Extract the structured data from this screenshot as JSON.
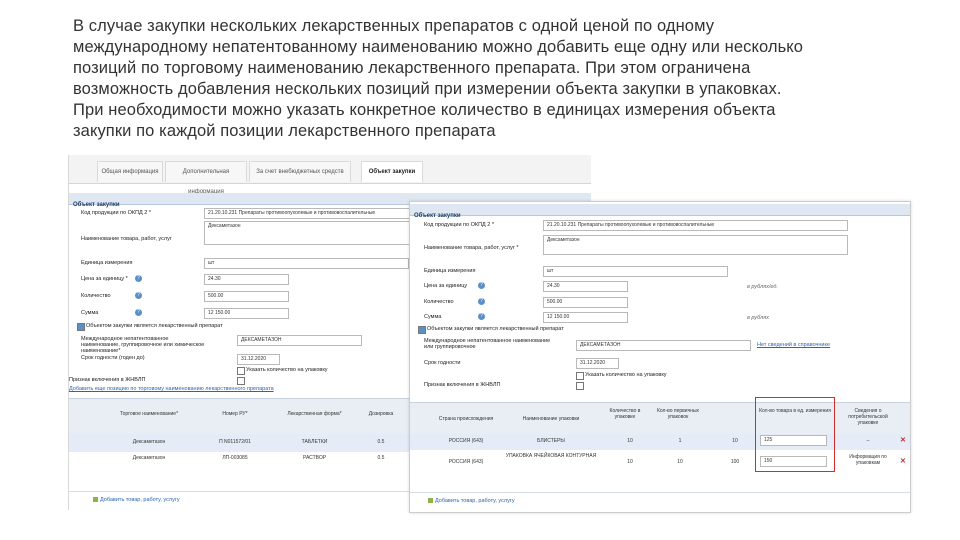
{
  "intro_lines": [
    "В случае закупки нескольких лекарственных препаратов с одной ценой по одному",
    "международному непатентованному наименованию можно добавить еще одну или несколько",
    "позиций по торговому наименованию лекарственного препарата. При этом ограничена",
    "возможность добавления нескольких позиций при измерении объекта закупки в упаковках.",
    "При необходимости можно указать конкретное количество в единицах измерения объекта",
    "закупки по каждой позиции лекарственного препарата"
  ],
  "back": {
    "tabs": [
      "Общая информация",
      "Дополнительная информация",
      "За счет внебюджетных средств",
      "Объект закупки"
    ],
    "section": "Объект закупки",
    "fields": [
      {
        "label": "Код продукции по ОКПД 2 *",
        "value": "21.20.10.231 Препараты противоопухолевые и противовоспалительные"
      },
      {
        "label": "Наименование товара, работ, услуг",
        "value": "Дексаметазон"
      },
      {
        "label": "Единица измерения",
        "value": "шт"
      },
      {
        "label": "Цена за единицу *",
        "value": "24.30"
      },
      {
        "label": "Количество",
        "value": "500.00"
      },
      {
        "label": "Сумма",
        "value": "12 150.00"
      }
    ],
    "checkbox_label": "Объектом закупки является лекарственный препарат",
    "mnn_label": "Международное непатентованное наименование, группировочное или химическое наименование*",
    "mnn_value": "ДЕКСАМЕТАЗОН",
    "expiry_label": "Срок годности (годен до)",
    "expiry_value": "31.12.2020",
    "checkbox2": "Указать количество на упаковку",
    "included_label": "Признак включения в ЖНВЛП",
    "add_link": "Добавить еще позицию по торговому наименованию лекарственного препарата",
    "table_headers": [
      "Торговое наименование*",
      "Номер РУ*",
      "Лекарственная форма*",
      "Дозировка"
    ],
    "rows": [
      [
        "Дексаметазон",
        "П N011572/01",
        "ТАБЛЕТКИ",
        "0.5"
      ],
      [
        "Дексаметазон",
        "ЛП-003085",
        "РАСТВОР",
        "0.5"
      ]
    ],
    "add_button": "Добавить товар, работу, услугу"
  },
  "front": {
    "section": "Объект закупки",
    "fields": [
      {
        "label": "Код продукции по ОКПД 2 *",
        "value": "21.20.10.231 Препараты противоопухолевые и противовоспалительные"
      },
      {
        "label": "Наименование товара, работ, услуг *",
        "value": "Дексаметазон"
      },
      {
        "label": "Единица измерения",
        "value": "шт"
      },
      {
        "label": "Цена за единицу",
        "value": "24.30"
      },
      {
        "label": "Количество",
        "value": "500.00"
      },
      {
        "label": "Сумма",
        "value": "12 150.00"
      }
    ],
    "side_notes": [
      "в рублях/ед.",
      "в рублях"
    ],
    "checkbox_label": "Объектом закупки является лекарственный препарат",
    "mnn_label": "Международное непатентованное наименование или группировочное",
    "mnn_value": "ДЕКСАМЕТАЗОН",
    "mnn_link": "Нет сведений в справочнике",
    "expiry_label": "Срок годности",
    "expiry_value": "31.12.2020",
    "checkbox2": "Указать количество на упаковку",
    "included_label": "Признак включения в ЖНВЛП",
    "table_headers": [
      "Страна происхождения",
      "Наименование упаковки",
      "Количество в упаковке",
      "Кол-во первичных упаковок",
      "Кол-во товара в ед. измерения",
      "Сведения о потребительской упаковке"
    ],
    "rows": [
      [
        "РОССИЯ (643)",
        "БЛИСТЕРЫ",
        "10",
        "1",
        "10",
        "125",
        "–"
      ],
      [
        "РОССИЯ (643)",
        "УПАКОВКА ЯЧЕЙКОВАЯ КОНТУРНАЯ",
        "10",
        "10",
        "100",
        "150",
        "Информация по упаковкам"
      ]
    ],
    "add_button": "Добавить товар, работу, услугу"
  },
  "colors": {
    "highlight": "#d62b2b",
    "section": "#dfe8f2",
    "link": "#2a66b0"
  }
}
